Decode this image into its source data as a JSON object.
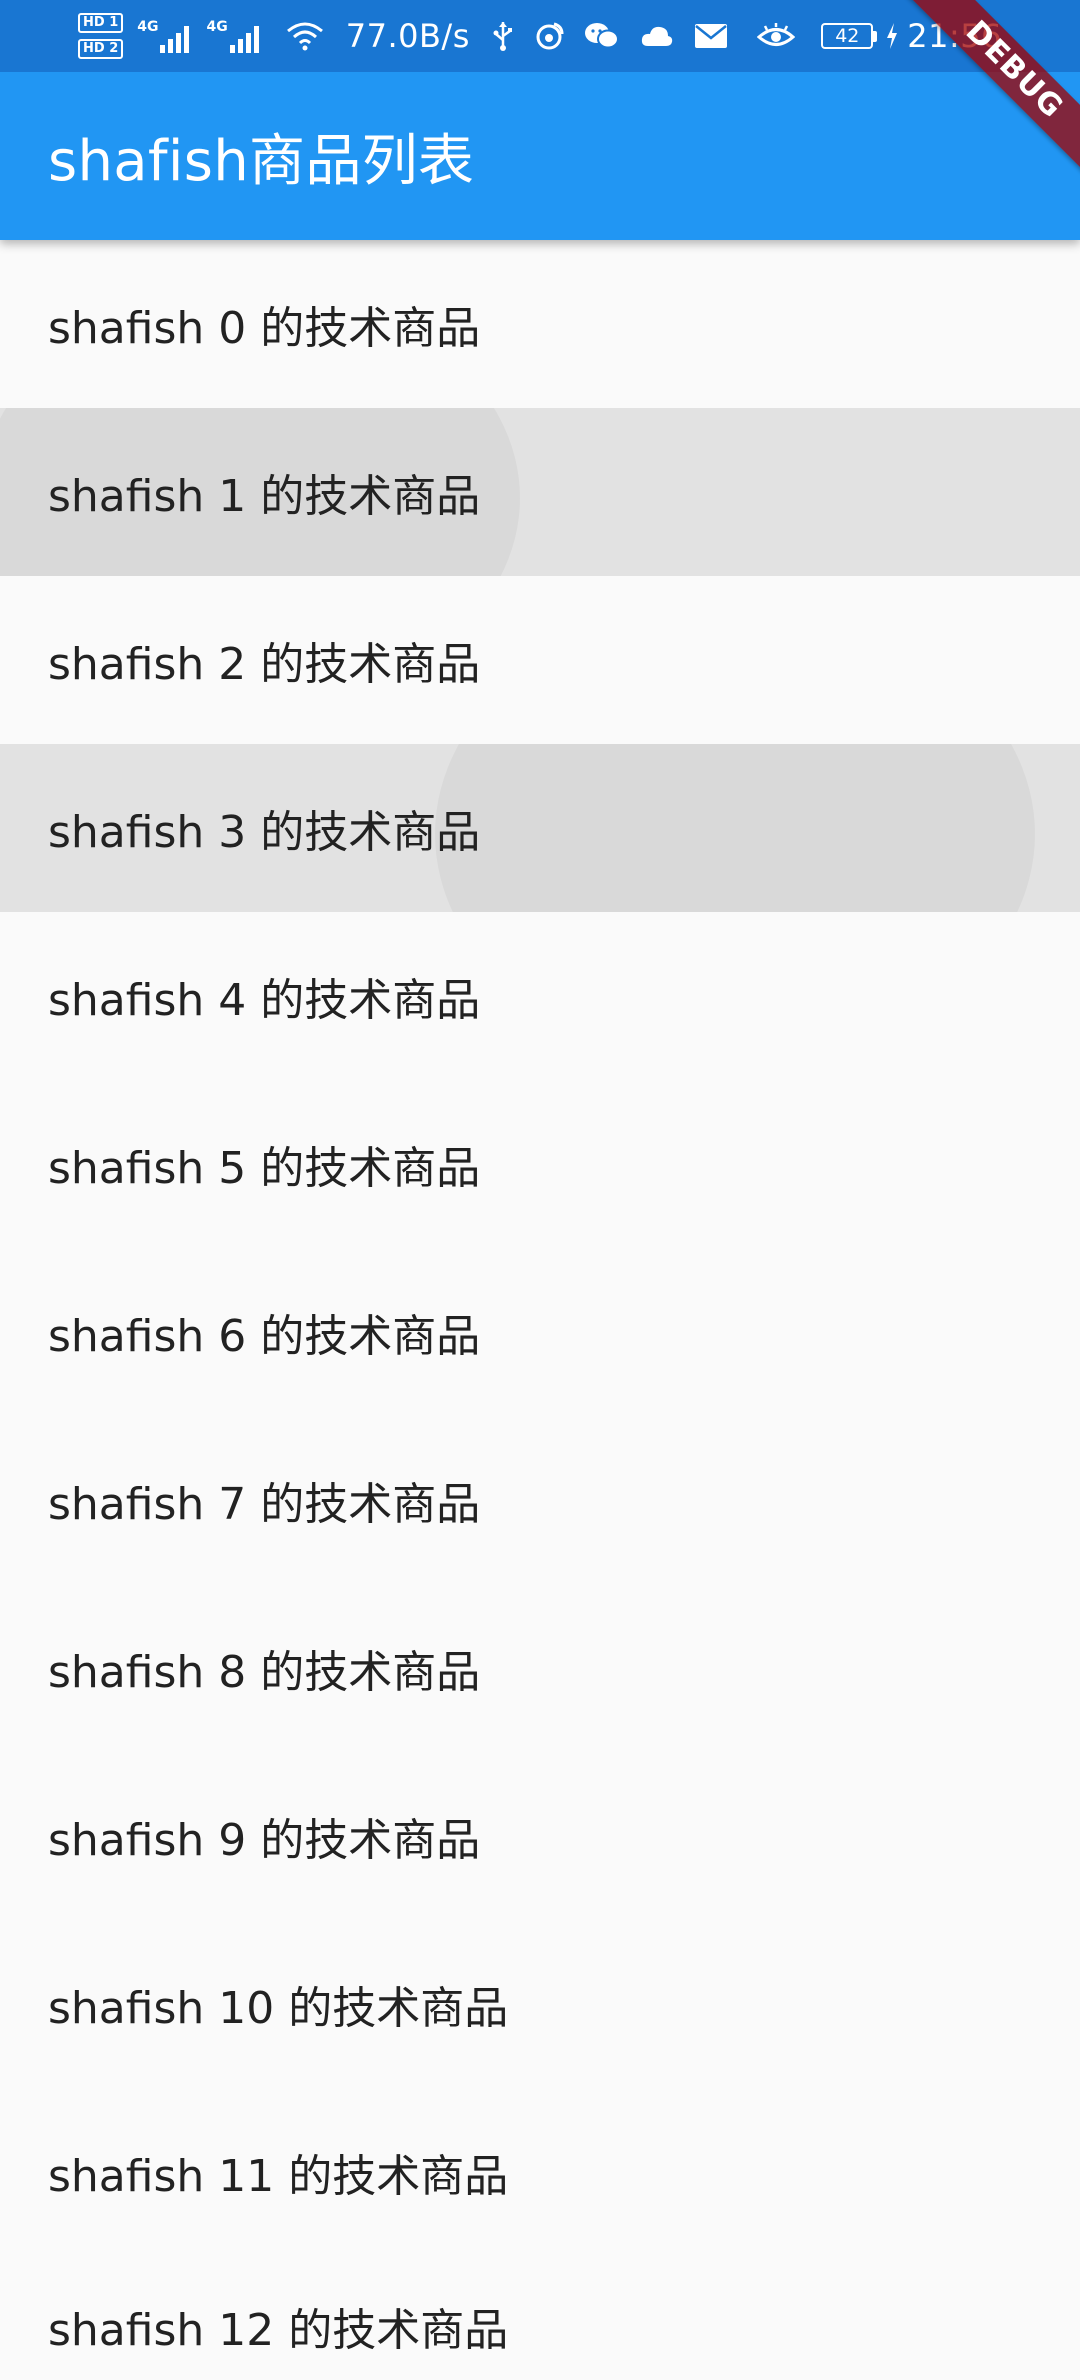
{
  "status_bar": {
    "hd1": "HD 1",
    "hd2": "HD 2",
    "sig1_label": "4G",
    "sig2_label": "4G",
    "net_speed": "77.0B/s",
    "battery": "42",
    "time": "21:56",
    "icons": [
      "wifi-icon",
      "usb-icon",
      "weibo-icon",
      "wechat-icon",
      "cloud-icon",
      "mail-icon",
      "eye-icon",
      "charging-icon"
    ]
  },
  "debug_banner": "DEBUG",
  "app_bar": {
    "title": "shafish商品列表",
    "color": "#2196f3"
  },
  "list": {
    "items": [
      "shafish 0 的技术商品",
      "shafish 1 的技术商品",
      "shafish 2 的技术商品",
      "shafish 3 的技术商品",
      "shafish 4 的技术商品",
      "shafish 5 的技术商品",
      "shafish 6 的技术商品",
      "shafish 7 的技术商品",
      "shafish 8 的技术商品",
      "shafish 9 的技术商品",
      "shafish 10 的技术商品",
      "shafish 11 的技术商品",
      "shafish 12 的技术商品"
    ]
  }
}
